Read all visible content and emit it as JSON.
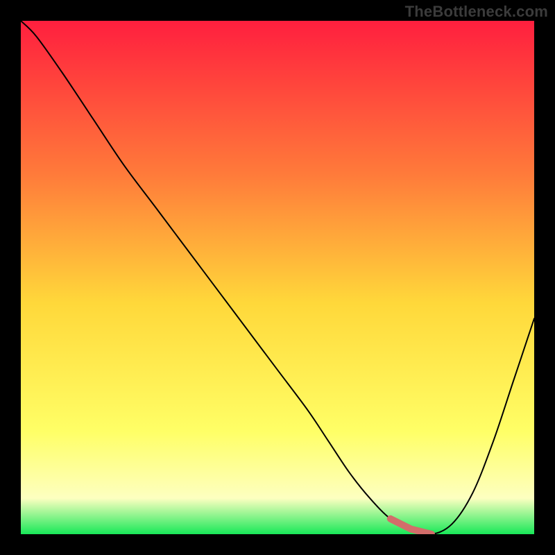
{
  "watermark": "TheBottleneck.com",
  "colors": {
    "gradient_top": "#ff1f3e",
    "gradient_mid1": "#ff7b3a",
    "gradient_mid2": "#ffd83a",
    "gradient_mid3": "#ffff66",
    "gradient_mid4": "#fdffc0",
    "gradient_bottom": "#18e858",
    "curve": "#000000",
    "marker": "#d26d6a",
    "background": "#000000"
  },
  "chart_data": {
    "type": "line",
    "title": "",
    "xlabel": "",
    "ylabel": "",
    "xlim": [
      0,
      100
    ],
    "ylim": [
      0,
      100
    ],
    "x": [
      0,
      3,
      8,
      14,
      20,
      26,
      32,
      38,
      44,
      50,
      56,
      60,
      64,
      68,
      72,
      76,
      80,
      84,
      88,
      92,
      96,
      100
    ],
    "values": [
      100,
      97,
      90,
      81,
      72,
      64,
      56,
      48,
      40,
      32,
      24,
      18,
      12,
      7,
      3,
      1,
      0,
      2,
      8,
      18,
      30,
      42
    ],
    "series": [
      {
        "name": "bottleneck-curve",
        "x": [
          0,
          3,
          8,
          14,
          20,
          26,
          32,
          38,
          44,
          50,
          56,
          60,
          64,
          68,
          72,
          76,
          80,
          84,
          88,
          92,
          96,
          100
        ],
        "values": [
          100,
          97,
          90,
          81,
          72,
          64,
          56,
          48,
          40,
          32,
          24,
          18,
          12,
          7,
          3,
          1,
          0,
          2,
          8,
          18,
          30,
          42
        ]
      }
    ],
    "marker_range_x": [
      70,
      83
    ],
    "annotations": []
  }
}
